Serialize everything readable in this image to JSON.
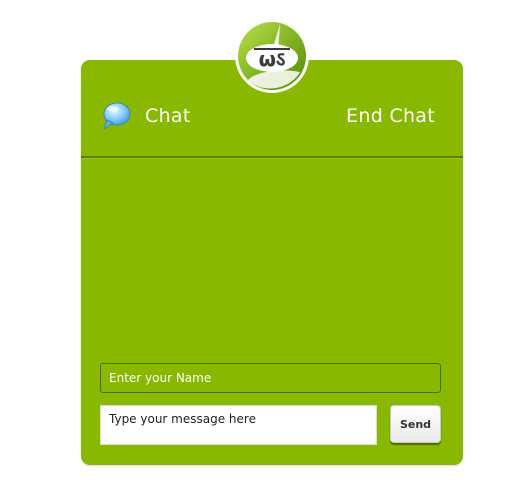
{
  "logo": {
    "text": "ωऽ",
    "brand_color": "#88b900"
  },
  "header": {
    "title": "Chat",
    "end_chat_label": "End Chat",
    "title_icon": "speech-bubble-icon"
  },
  "form": {
    "name_placeholder": "Enter your Name",
    "message_placeholder": "Type your message here",
    "send_label": "Send"
  },
  "colors": {
    "panel": "#88b900",
    "text": "#ffffff"
  }
}
